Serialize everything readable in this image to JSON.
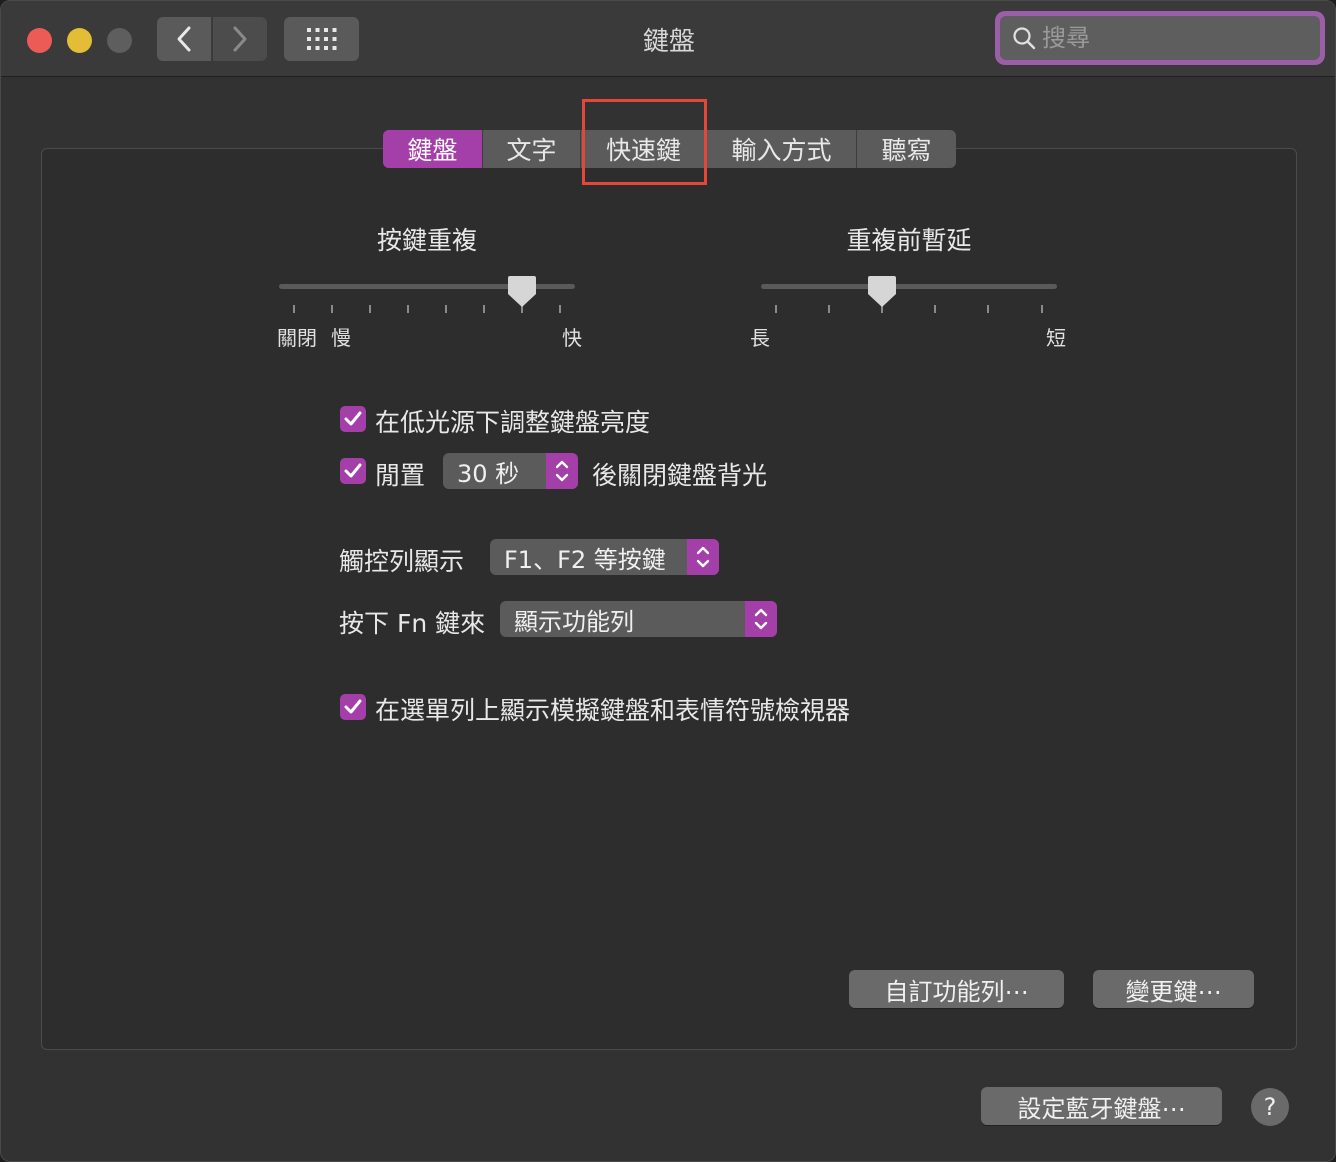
{
  "window": {
    "title": "鍵盤"
  },
  "toolbar": {
    "back_icon": "chevron-left-icon",
    "forward_icon": "chevron-right-icon",
    "grid_icon": "grid-icon"
  },
  "search": {
    "placeholder": "搜尋"
  },
  "tabs": [
    {
      "label": "鍵盤",
      "active": true
    },
    {
      "label": "文字",
      "active": false
    },
    {
      "label": "快速鍵",
      "active": false
    },
    {
      "label": "輸入方式",
      "active": false
    },
    {
      "label": "聽寫",
      "active": false
    }
  ],
  "key_repeat": {
    "title": "按鍵重複",
    "label_off": "關閉",
    "label_slow": "慢",
    "label_fast": "快",
    "value_fraction": 0.82
  },
  "delay_until_repeat": {
    "title": "重複前暫延",
    "label_long": "長",
    "label_short": "短",
    "value_fraction": 0.41
  },
  "options": {
    "adjust_brightness": {
      "label": "在低光源下調整鍵盤亮度",
      "checked": true
    },
    "backlight_off": {
      "prefix": "閒置",
      "value": "30 秒",
      "suffix": "後關閉鍵盤背光",
      "checked": true
    },
    "touchbar_shows": {
      "label": "觸控列顯示",
      "value": "F1、F2 等按鍵"
    },
    "fn_key": {
      "label": "按下 Fn 鍵來",
      "value": "顯示功能列"
    },
    "menu_bar_viewer": {
      "label": "在選單列上顯示模擬鍵盤和表情符號檢視器",
      "checked": true
    }
  },
  "buttons": {
    "customize_touchbar": "自訂功能列⋯",
    "modifier_keys": "變更鍵⋯",
    "bluetooth_keyboard": "設定藍牙鍵盤⋯",
    "help": "?"
  },
  "colors": {
    "accent": "#a43ea8",
    "highlight_box": "#e5463a"
  }
}
